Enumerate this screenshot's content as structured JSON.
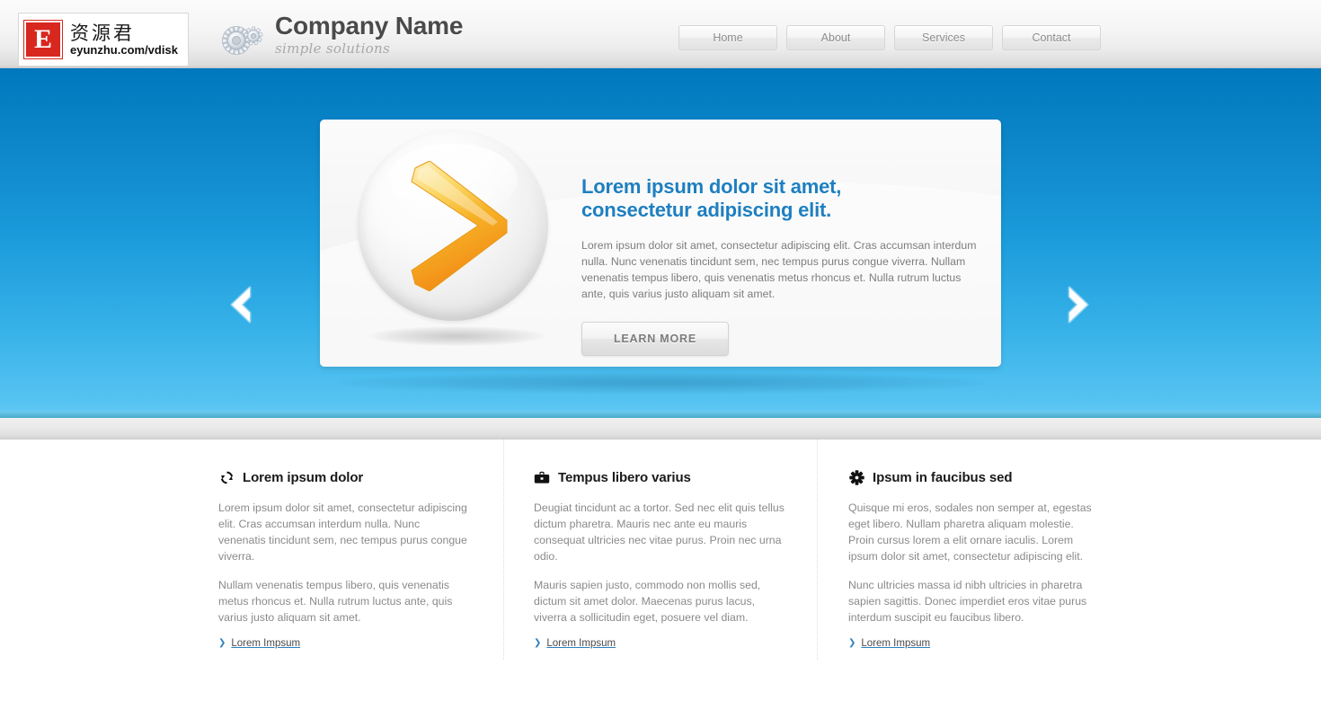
{
  "header": {
    "watermark": {
      "badge_letter": "E",
      "chinese": "资源君",
      "url": "eyunzhu.com/vdisk"
    },
    "brand": {
      "name": "Company Name",
      "tagline": "simple solutions",
      "logo_icon": "gears-icon"
    },
    "nav": [
      {
        "label": "Home"
      },
      {
        "label": "About"
      },
      {
        "label": "Services"
      },
      {
        "label": "Contact"
      }
    ]
  },
  "banner": {
    "prev_icon": "chevron-left-icon",
    "next_icon": "chevron-right-icon",
    "orb_icon": "orange-chevron-orb",
    "slide": {
      "title_line1": "Lorem ipsum dolor sit amet,",
      "title_line2": "consectetur adipiscing elit.",
      "body": "Lorem ipsum dolor sit amet, consectetur adipiscing elit. Cras accumsan interdum nulla. Nunc venenatis tincidunt sem, nec tempus purus congue viverra. Nullam venenatis tempus libero, quis venenatis metus rhoncus et. Nulla rutrum luctus ante, quis varius justo aliquam sit amet.",
      "cta_label": "LEARN MORE"
    }
  },
  "columns": [
    {
      "icon": "refresh-icon",
      "title": "Lorem ipsum dolor",
      "p1": "Lorem ipsum dolor sit amet, consectetur adipiscing elit. Cras accumsan interdum nulla. Nunc venenatis tincidunt sem, nec tempus purus congue viverra.",
      "p2": "Nullam venenatis tempus libero, quis venenatis metus rhoncus et. Nulla rutrum luctus ante, quis varius justo aliquam sit amet.",
      "link_label": "Lorem Impsum"
    },
    {
      "icon": "briefcase-icon",
      "title": "Tempus libero varius",
      "p1": "Deugiat tincidunt ac a tortor. Sed nec elit quis tellus dictum pharetra. Mauris nec ante eu mauris consequat ultricies nec vitae purus. Proin nec urna odio.",
      "p2": "Mauris sapien justo, commodo non mollis sed, dictum sit amet dolor. Maecenas purus lacus, viverra a sollicitudin eget, posuere vel diam.",
      "link_label": "Lorem Impsum"
    },
    {
      "icon": "gear-icon",
      "title": "Ipsum in faucibus sed",
      "p1": "Quisque mi eros, sodales non semper at, egestas eget libero. Nullam pharetra aliquam molestie. Proin cursus lorem a elit ornare iaculis. Lorem ipsum dolor sit amet, consectetur adipiscing elit.",
      "p2": "Nunc ultricies massa id nibh ultricies in pharetra sapien sagittis. Donec imperdiet eros vitae purus interdum suscipit eu faucibus libero.",
      "link_label": "Lorem Impsum"
    }
  ],
  "colors": {
    "banner_top": "#0078bd",
    "banner_bottom": "#66caf4",
    "heading_blue": "#1e7fc0",
    "link_blue": "#2a7fc0",
    "logo_red": "#d8271f",
    "arrow_orange": "#f5a623"
  }
}
